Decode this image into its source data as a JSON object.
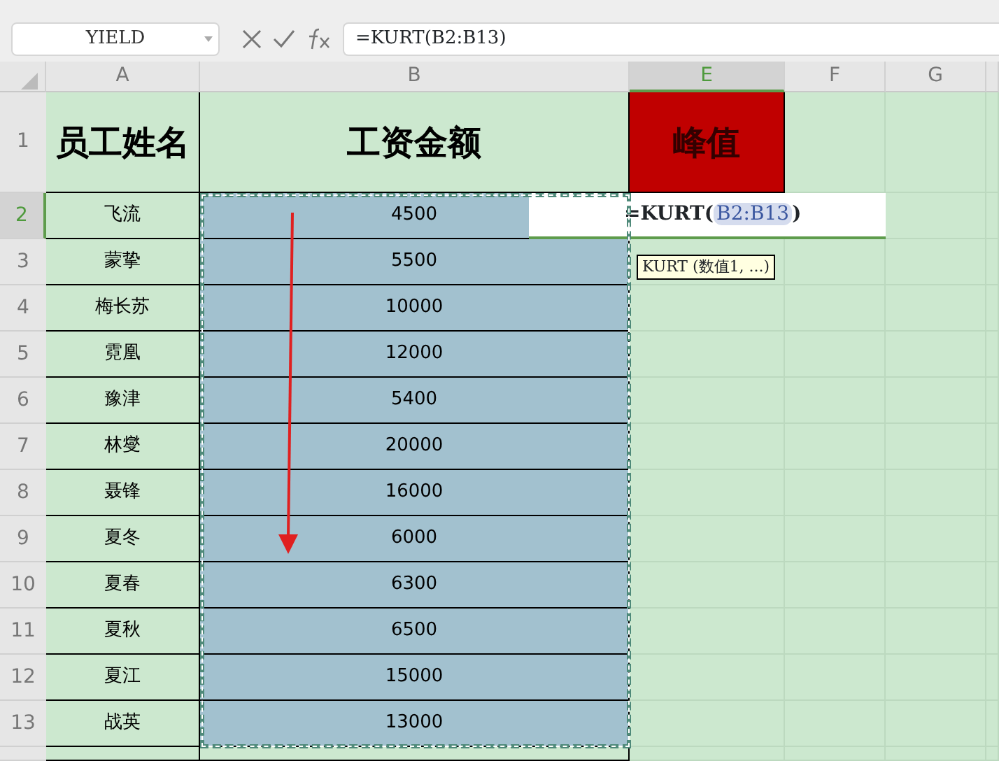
{
  "name_box": "YIELD",
  "formula_bar": "=KURT(B2:B13)",
  "columns": [
    {
      "label": "A",
      "selected": false
    },
    {
      "label": "B",
      "selected": false
    },
    {
      "label": "E",
      "selected": true
    },
    {
      "label": "F",
      "selected": false
    },
    {
      "label": "G",
      "selected": false
    }
  ],
  "header_row": {
    "header": "1",
    "selected": false,
    "cells": [
      "员工姓名",
      "工资金额",
      "峰值"
    ]
  },
  "rows": [
    {
      "header": "2",
      "selected": true,
      "cells": [
        "飞流",
        "4500"
      ]
    },
    {
      "header": "3",
      "selected": false,
      "cells": [
        "蒙挚",
        "5500"
      ]
    },
    {
      "header": "4",
      "selected": false,
      "cells": [
        "梅长苏",
        "10000"
      ]
    },
    {
      "header": "5",
      "selected": false,
      "cells": [
        "霓凰",
        "12000"
      ]
    },
    {
      "header": "6",
      "selected": false,
      "cells": [
        "豫津",
        "5400"
      ]
    },
    {
      "header": "7",
      "selected": false,
      "cells": [
        "林燮",
        "20000"
      ]
    },
    {
      "header": "8",
      "selected": false,
      "cells": [
        "聂锋",
        "16000"
      ]
    },
    {
      "header": "9",
      "selected": false,
      "cells": [
        "夏冬",
        "6000"
      ]
    },
    {
      "header": "10",
      "selected": false,
      "cells": [
        "夏春",
        "6300"
      ]
    },
    {
      "header": "11",
      "selected": false,
      "cells": [
        "夏秋",
        "6500"
      ]
    },
    {
      "header": "12",
      "selected": false,
      "cells": [
        "夏江",
        "15000"
      ]
    },
    {
      "header": "13",
      "selected": false,
      "cells": [
        "战英",
        "13000"
      ]
    }
  ],
  "cell_editor": {
    "prefix": "=KURT(",
    "reference": "B2:B13",
    "suffix": ")"
  },
  "tooltip": "KURT (数值1, ...)"
}
